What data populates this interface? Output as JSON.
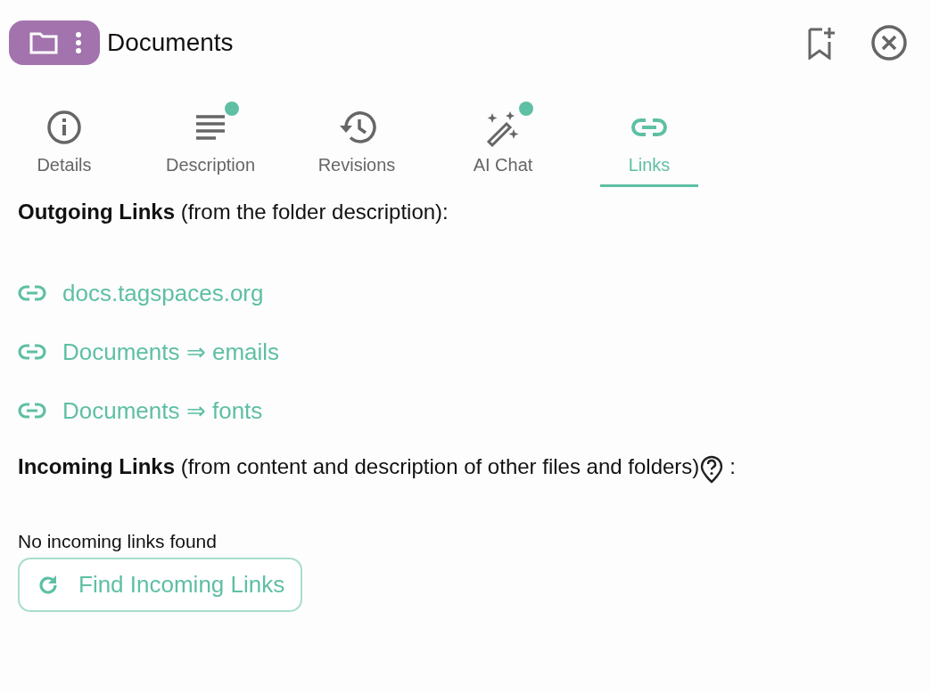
{
  "header": {
    "title": "Documents"
  },
  "tabs": [
    {
      "label": "Details",
      "kind": "info",
      "badge": false,
      "selected": false
    },
    {
      "label": "Description",
      "kind": "text",
      "badge": true,
      "selected": false
    },
    {
      "label": "Revisions",
      "kind": "history",
      "badge": false,
      "selected": false
    },
    {
      "label": "AI Chat",
      "kind": "magic",
      "badge": true,
      "selected": false
    },
    {
      "label": "Links",
      "kind": "link",
      "badge": false,
      "selected": true
    }
  ],
  "outgoing": {
    "heading": "**Outgoing Links** (from the folder description):",
    "links": [
      "docs.tagspaces.org",
      "Documents ⇒ emails",
      "Documents ⇒ fonts"
    ]
  },
  "incoming": {
    "heading": "**Incoming Links** (from content and description of other files and folders)",
    "colon": ":",
    "empty_message": "No incoming links found",
    "button": "Find Incoming Links"
  }
}
